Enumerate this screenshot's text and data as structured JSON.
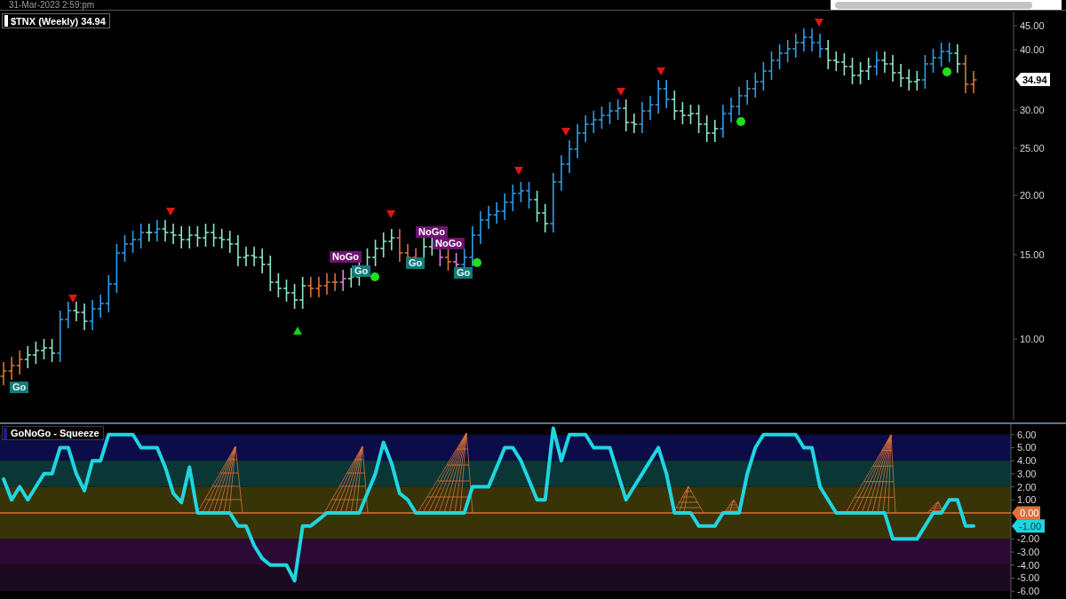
{
  "header": {
    "timestamp": "31-Mar-2023 2:59:pm"
  },
  "price_panel": {
    "legend": "$TNX (Weekly) 34.94",
    "signal_tags": [
      {
        "kind": "go",
        "text": "Go"
      },
      {
        "kind": "nogo",
        "text": "NoGo"
      },
      {
        "kind": "go",
        "text": "Go"
      },
      {
        "kind": "go",
        "text": "Go"
      },
      {
        "kind": "nogo",
        "text": "NoGo"
      },
      {
        "kind": "nogo",
        "text": "NoGo"
      },
      {
        "kind": "go",
        "text": "Go"
      }
    ],
    "axis_ticks": [
      "45.00",
      "40.00",
      "30.00",
      "25.00",
      "20.00",
      "15.00",
      "10.00"
    ],
    "last_price": "34.94"
  },
  "oscillator_panel": {
    "legend": "GoNoGo - Squeeze",
    "last_value_label": "-1.00",
    "chart_data": {
      "type": "line",
      "ylim": [
        -6.6,
        6.8
      ],
      "yticks": [
        {
          "value": 6,
          "label": "6.00"
        },
        {
          "value": 5,
          "label": "5.00"
        },
        {
          "value": 4,
          "label": "4.00"
        },
        {
          "value": 3,
          "label": "3.00"
        },
        {
          "value": 2,
          "label": "2.00"
        },
        {
          "value": 1,
          "label": "1.00"
        },
        {
          "value": -2,
          "label": "-2.00"
        },
        {
          "value": -3,
          "label": "-3.00"
        },
        {
          "value": -4,
          "label": "-4.00"
        },
        {
          "value": -5,
          "label": "-5.00"
        },
        {
          "value": -6,
          "label": "-6.00"
        }
      ],
      "bands": [
        {
          "axis": "y",
          "from": 4,
          "to": 6,
          "color": "#0c0c48"
        },
        {
          "axis": "y",
          "from": 2,
          "to": 4,
          "color": "#0a3636"
        },
        {
          "axis": "y",
          "from": -2,
          "to": 2,
          "color": "#393408"
        },
        {
          "axis": "y",
          "from": -4,
          "to": -2,
          "color": "#2b0a36"
        },
        {
          "axis": "y",
          "from": -6,
          "to": -4,
          "color": "#1b0a20"
        }
      ],
      "ref_lines": [
        {
          "axis": "y",
          "value": 0,
          "label": "0.00",
          "color": "#d9733a"
        }
      ],
      "series": [
        {
          "color": "#1fd6e0",
          "values": [
            2.6,
            1,
            2,
            1,
            2,
            3,
            3,
            5,
            5,
            3,
            1.7,
            4,
            4,
            6,
            6,
            6,
            6,
            5,
            5,
            5,
            3.5,
            1.5,
            0.8,
            3.5,
            0,
            0,
            0,
            0,
            0,
            -1,
            -1,
            -2.5,
            -3.5,
            -4,
            -4,
            -4,
            -5.2,
            -1,
            -1,
            -0.5,
            0,
            0,
            0,
            0,
            0,
            1.5,
            3,
            5.4,
            3.8,
            1.5,
            1,
            0,
            0,
            0,
            0,
            0,
            0,
            0,
            2,
            2,
            2,
            3.5,
            5,
            5,
            4,
            2.5,
            1,
            1,
            6.5,
            4,
            6,
            6,
            6,
            5,
            5,
            5,
            3,
            1,
            2,
            3,
            4,
            5,
            3,
            0,
            0,
            0,
            -1,
            -1,
            -1,
            0,
            0,
            0,
            3,
            5,
            6,
            6,
            6,
            6,
            6,
            5,
            5,
            2,
            1,
            0,
            0,
            0,
            0,
            0,
            0,
            0,
            -2,
            -2,
            -2,
            -2,
            -1,
            0,
            0,
            1,
            1,
            -1,
            -1
          ]
        }
      ]
    }
  }
}
